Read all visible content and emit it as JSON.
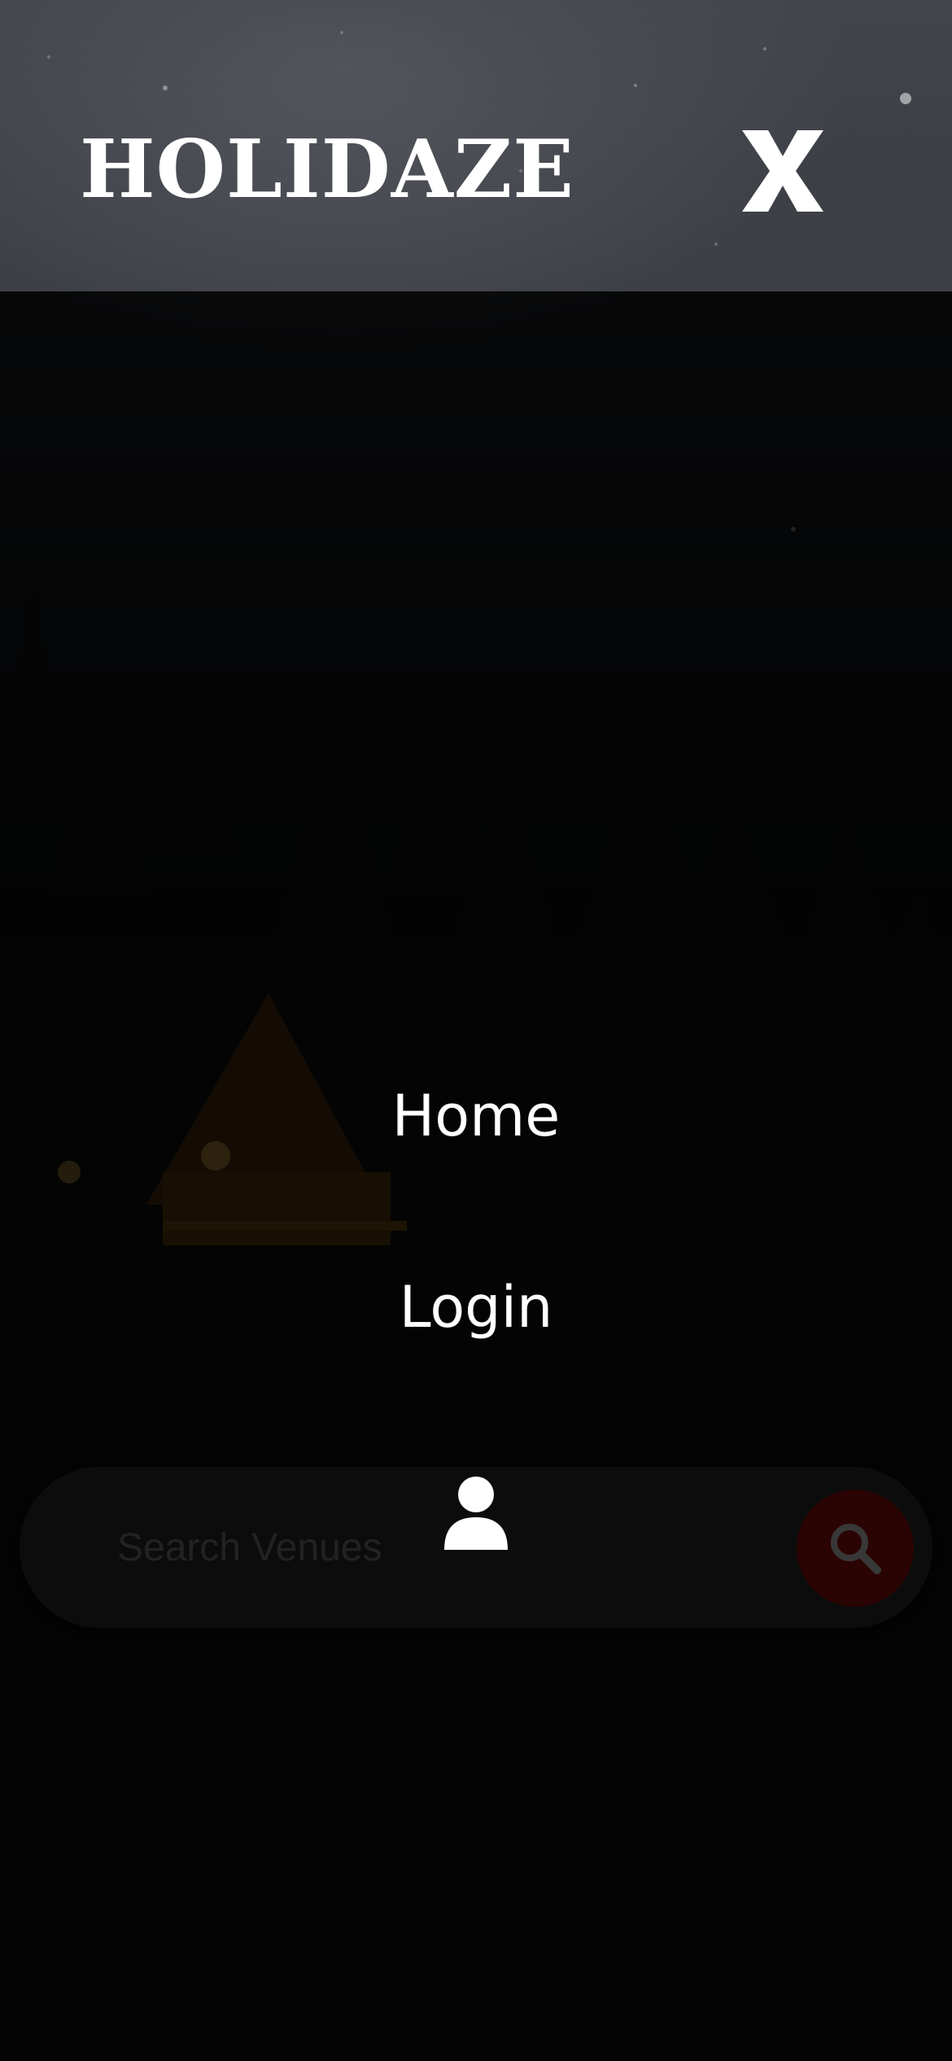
{
  "header": {
    "brand": "HOLIDAZE",
    "close_label": "X"
  },
  "menu": {
    "items": [
      {
        "label": "Home"
      },
      {
        "label": "Login"
      }
    ],
    "profile_icon": "user-icon"
  },
  "search": {
    "placeholder": "Search Venues",
    "button_icon": "search-icon"
  },
  "colors": {
    "accent": "#c0140c",
    "text": "#ffffff",
    "overlay": "#000000"
  }
}
